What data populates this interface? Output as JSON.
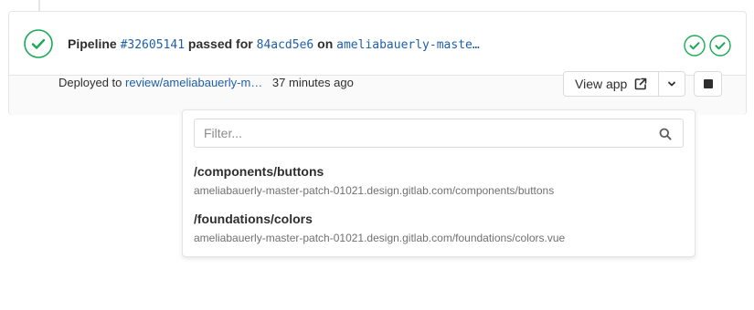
{
  "pipeline": {
    "label": "Pipeline",
    "id": "#32605141",
    "status_text": "passed for",
    "commit": "84acd5e6",
    "on_text": "on",
    "branch": "ameliabauerly-maste…",
    "status_color": "#1aaa55",
    "stage_icons": [
      "success-icon",
      "success-icon"
    ]
  },
  "deployment": {
    "prefix": "Deployed to",
    "environment": "review/ameliabauerly-m…",
    "time_ago": "37 minutes ago",
    "view_app_label": "View app"
  },
  "dropdown": {
    "filter_placeholder": "Filter...",
    "filter_value": "",
    "routes": [
      {
        "path": "/components/buttons",
        "url": "ameliabauerly-master-patch-01021.design.gitlab.com/components/buttons"
      },
      {
        "path": "/foundations/colors",
        "url": "ameliabauerly-master-patch-01021.design.gitlab.com/foundations/colors.vue"
      }
    ]
  },
  "colors": {
    "link": "#1f5fa8",
    "success": "#1aaa55",
    "text": "#2e2e2e",
    "muted": "#707070"
  }
}
